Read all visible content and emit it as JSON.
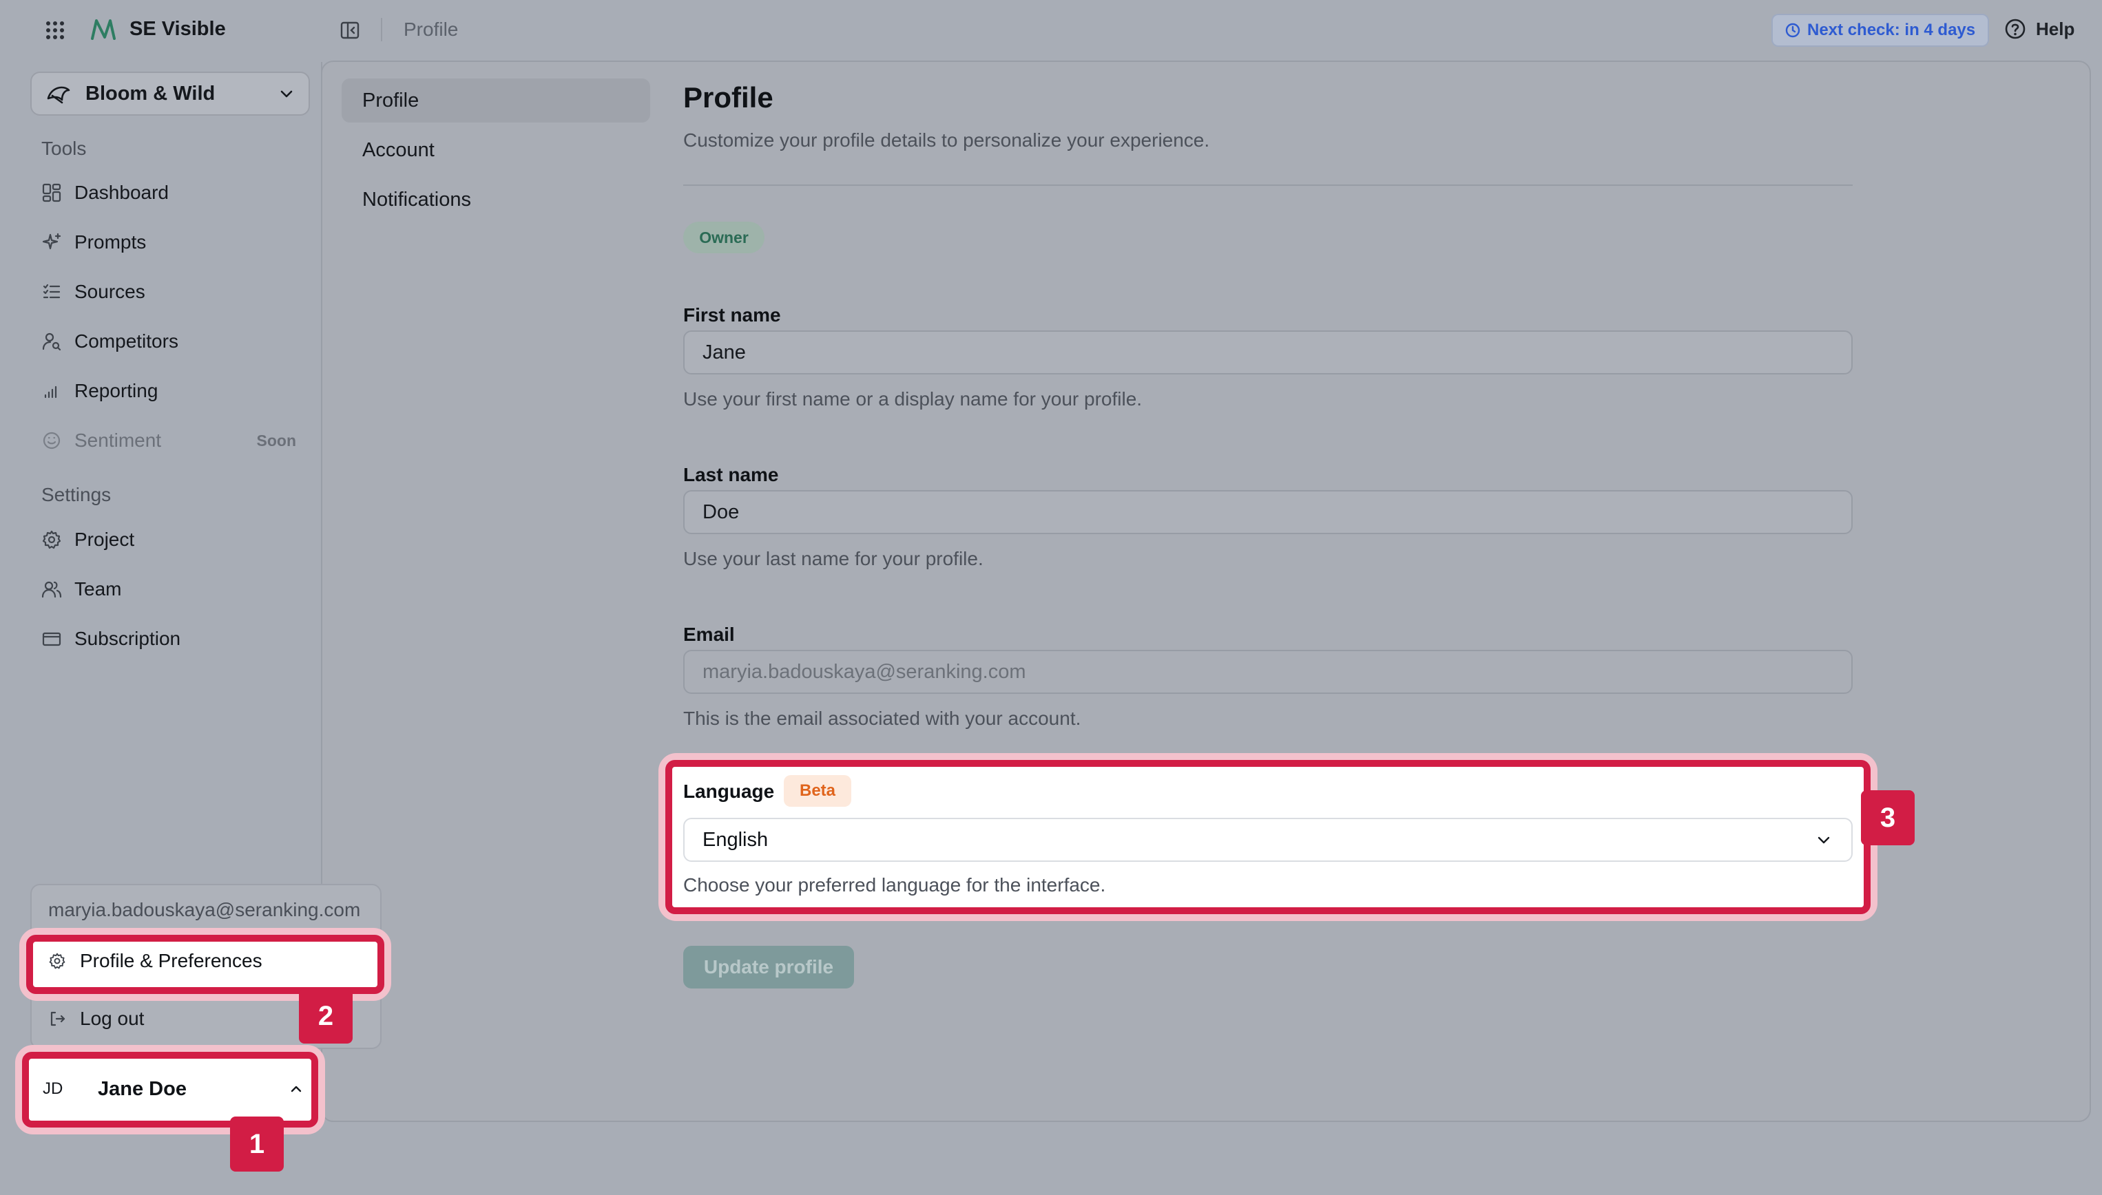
{
  "header": {
    "app_name": "SE Visible",
    "breadcrumb": "Profile",
    "next_check": "Next check: in 4 days",
    "help": "Help"
  },
  "sidebar": {
    "project": "Bloom & Wild",
    "tools_title": "Tools",
    "tools": [
      {
        "label": "Dashboard",
        "icon": "dashboard-icon"
      },
      {
        "label": "Prompts",
        "icon": "sparkle-icon"
      },
      {
        "label": "Sources",
        "icon": "list-icon"
      },
      {
        "label": "Competitors",
        "icon": "user-search-icon"
      },
      {
        "label": "Reporting",
        "icon": "bar-chart-icon"
      },
      {
        "label": "Sentiment",
        "icon": "smile-icon",
        "badge": "Soon"
      }
    ],
    "settings_title": "Settings",
    "settings": [
      {
        "label": "Project",
        "icon": "gear-icon"
      },
      {
        "label": "Team",
        "icon": "users-icon"
      },
      {
        "label": "Subscription",
        "icon": "card-icon"
      }
    ]
  },
  "user_menu": {
    "email": "maryia.badouskaya@seranking.com",
    "profile_prefs": "Profile & Preferences",
    "logout": "Log out",
    "initials": "JD",
    "name": "Jane Doe"
  },
  "subnav": {
    "items": [
      "Profile",
      "Account",
      "Notifications"
    ],
    "active": "Profile"
  },
  "profile": {
    "title": "Profile",
    "description": "Customize your profile details to personalize your experience.",
    "role_badge": "Owner",
    "first_name_label": "First name",
    "first_name": "Jane",
    "first_name_help": "Use your first name or a display name for your profile.",
    "last_name_label": "Last name",
    "last_name": "Doe",
    "last_name_help": "Use your last name for your profile.",
    "email_label": "Email",
    "email": "maryia.badouskaya@seranking.com",
    "email_help": "This is the email associated with your account.",
    "language_label": "Language",
    "language_badge": "Beta",
    "language": "English",
    "language_help": "Choose your preferred language for the interface.",
    "update_button": "Update profile"
  },
  "annotations": {
    "step1": "1",
    "step2": "2",
    "step3": "3"
  },
  "colors": {
    "highlight": "#d21d45",
    "highlight_glow": "#f3c1cc",
    "beta": "#e0641c",
    "owner": "#2b6b55",
    "next_check": "#2e5bd1"
  }
}
